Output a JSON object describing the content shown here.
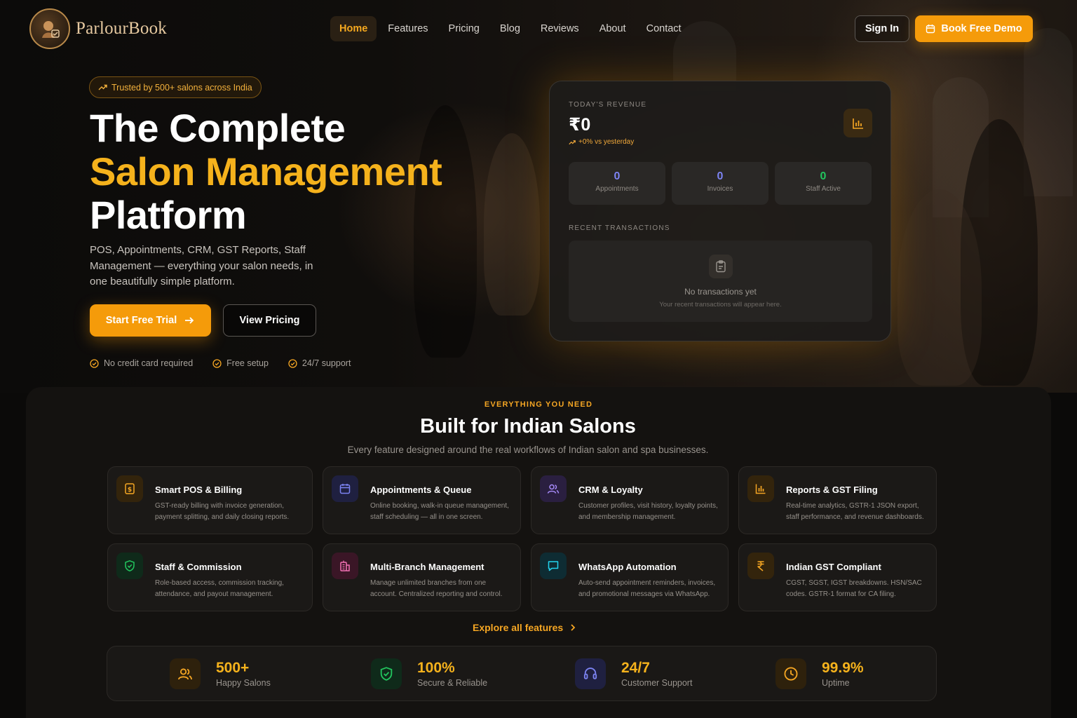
{
  "brand": {
    "name": "ParlourBook",
    "accent": "#f59b0a"
  },
  "nav": {
    "links": [
      "Home",
      "Features",
      "Pricing",
      "Blog",
      "Reviews",
      "About",
      "Contact"
    ],
    "active": "Home",
    "sign_in": "Sign In",
    "book_demo": "Book Free Demo"
  },
  "hero": {
    "badge": "Trusted by 500+ salons across India",
    "title_line1": "The Complete",
    "title_line2": "Salon Management",
    "title_line3": "Platform",
    "subtitle": "POS, Appointments, CRM, GST Reports, Staff Management — everything your salon needs, in one beautifully simple platform.",
    "cta_primary": "Start Free Trial",
    "cta_secondary": "View Pricing",
    "perks": [
      "No credit card required",
      "Free setup",
      "24/7 support"
    ]
  },
  "dashboard": {
    "revenue_label": "TODAY'S REVENUE",
    "revenue_value": "₹0",
    "revenue_delta": "+0% vs yesterday",
    "stats": [
      {
        "value": "0",
        "label": "Appointments",
        "color": "#7c83f2"
      },
      {
        "value": "0",
        "label": "Invoices",
        "color": "#7c83f2"
      },
      {
        "value": "0",
        "label": "Staff Active",
        "color": "#22c55e"
      }
    ],
    "recent_label": "RECENT TRANSACTIONS",
    "empty_title": "No transactions yet",
    "empty_sub": "Your recent transactions will appear here."
  },
  "features": {
    "kicker": "EVERYTHING YOU NEED",
    "title": "Built for Indian Salons",
    "subtitle": "Every feature designed around the real workflows of Indian salon and spa businesses.",
    "cards": [
      {
        "title": "Smart POS & Billing",
        "desc": "GST-ready billing with invoice generation, payment splitting, and daily closing reports.",
        "icon": "receipt-icon",
        "color": "#f5a623"
      },
      {
        "title": "Appointments & Queue",
        "desc": "Online booking, walk-in queue management, staff scheduling — all in one screen.",
        "icon": "calendar-icon",
        "color": "#7c83f2"
      },
      {
        "title": "CRM & Loyalty",
        "desc": "Customer profiles, visit history, loyalty points, and membership management.",
        "icon": "users-icon",
        "color": "#a78bfa"
      },
      {
        "title": "Reports & GST Filing",
        "desc": "Real-time analytics, GSTR-1 JSON export, staff performance, and revenue dashboards.",
        "icon": "bar-chart-icon",
        "color": "#f5a623"
      },
      {
        "title": "Staff & Commission",
        "desc": "Role-based access, commission tracking, attendance, and payout management.",
        "icon": "shield-check-icon",
        "color": "#22c55e"
      },
      {
        "title": "Multi-Branch Management",
        "desc": "Manage unlimited branches from one account. Centralized reporting and control.",
        "icon": "building-icon",
        "color": "#f472b6"
      },
      {
        "title": "WhatsApp Automation",
        "desc": "Auto-send appointment reminders, invoices, and promotional messages via WhatsApp.",
        "icon": "message-icon",
        "color": "#22d3ee"
      },
      {
        "title": "Indian GST Compliant",
        "desc": "CGST, SGST, IGST breakdowns. HSN/SAC codes. GSTR-1 format for CA filing.",
        "icon": "rupee-icon",
        "color": "#f5a623"
      }
    ],
    "explore": "Explore all features"
  },
  "stats": [
    {
      "value": "500+",
      "label": "Happy Salons",
      "icon": "users-icon",
      "color": "#f5a623"
    },
    {
      "value": "100%",
      "label": "Secure & Reliable",
      "icon": "shield-check-icon",
      "color": "#22c55e"
    },
    {
      "value": "24/7",
      "label": "Customer Support",
      "icon": "headset-icon",
      "color": "#7c83f2"
    },
    {
      "value": "99.9%",
      "label": "Uptime",
      "icon": "clock-icon",
      "color": "#f5a623"
    }
  ]
}
